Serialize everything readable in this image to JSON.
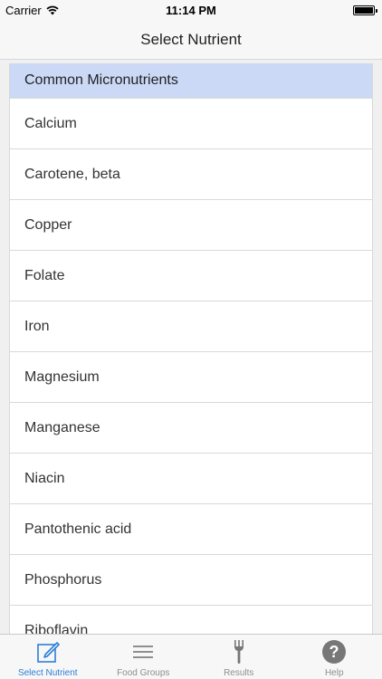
{
  "status_bar": {
    "carrier": "Carrier",
    "time": "11:14 PM"
  },
  "nav": {
    "title": "Select Nutrient"
  },
  "list": {
    "section_title": "Common Micronutrients",
    "items": [
      "Calcium",
      "Carotene, beta",
      "Copper",
      "Folate",
      "Iron",
      "Magnesium",
      "Manganese",
      "Niacin",
      "Pantothenic acid",
      "Phosphorus",
      "Riboflavin"
    ]
  },
  "tabs": [
    {
      "label": "Select Nutrient",
      "icon": "edit-icon",
      "active": true
    },
    {
      "label": "Food Groups",
      "icon": "menu-icon",
      "active": false
    },
    {
      "label": "Results",
      "icon": "fork-icon",
      "active": false
    },
    {
      "label": "Help",
      "icon": "help-icon",
      "active": false
    }
  ],
  "colors": {
    "accent": "#2b7fd6",
    "section_header": "#cbd9f7",
    "inactive": "#8e8e8e"
  }
}
